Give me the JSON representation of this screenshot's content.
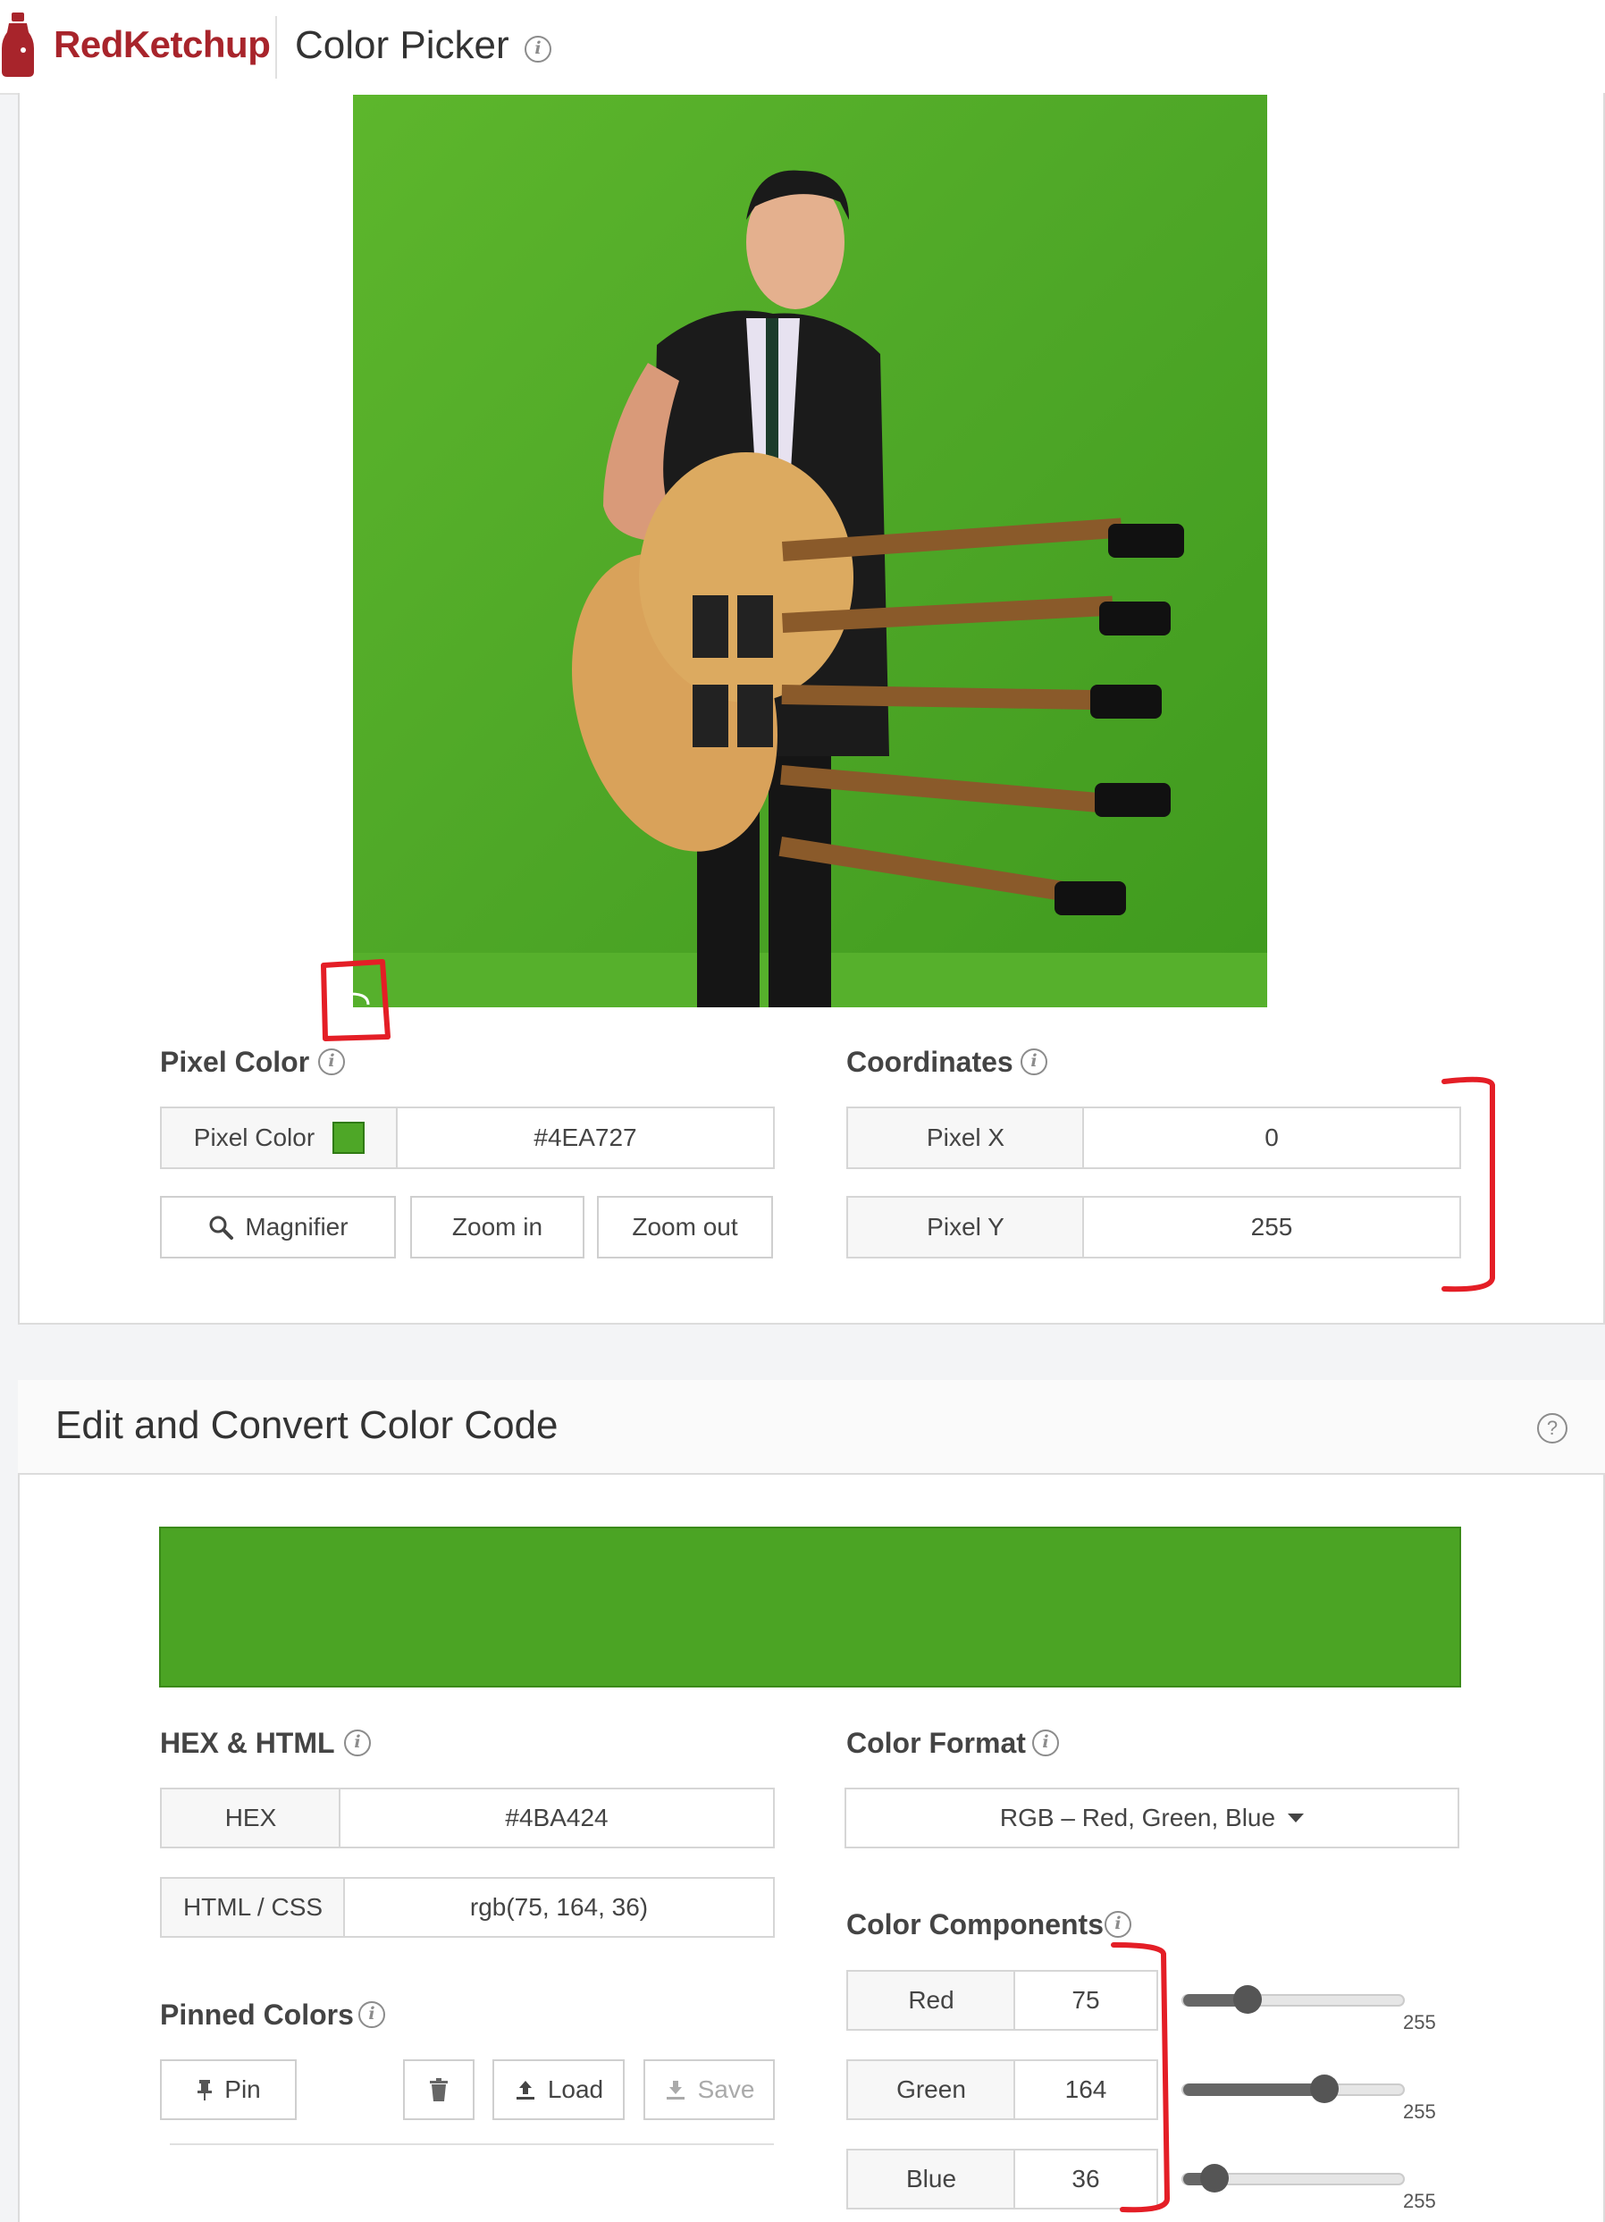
{
  "header": {
    "brand": "RedKetchup",
    "title": "Color Picker"
  },
  "pixel_section": {
    "label": "Pixel Color",
    "pixel_color_label": "Pixel Color",
    "pixel_color_value": "#4EA727",
    "swatch_color": "#4EA727",
    "magnifier": "Magnifier",
    "zoom_in": "Zoom in",
    "zoom_out": "Zoom out"
  },
  "coordinates": {
    "label": "Coordinates",
    "x_label": "Pixel X",
    "x_value": "0",
    "y_label": "Pixel Y",
    "y_value": "255"
  },
  "edit_panel": {
    "title": "Edit and Convert Color Code",
    "preview_color": "#4BA424"
  },
  "hex_html": {
    "label": "HEX & HTML",
    "hex_label": "HEX",
    "hex_value": "#4BA424",
    "css_label": "HTML / CSS",
    "css_value": "rgb(75, 164, 36)"
  },
  "color_format": {
    "label": "Color Format",
    "selected": "RGB – Red, Green, Blue"
  },
  "components": {
    "label": "Color Components",
    "red_label": "Red",
    "red_value": "75",
    "green_label": "Green",
    "green_value": "164",
    "blue_label": "Blue",
    "blue_value": "36",
    "max": "255",
    "red_level": 0.294,
    "green_level": 0.643,
    "blue_level": 0.141
  },
  "pinned": {
    "label": "Pinned Colors",
    "pin": "Pin",
    "load": "Load",
    "save": "Save"
  }
}
